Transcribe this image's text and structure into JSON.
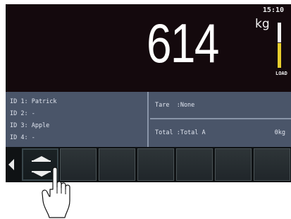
{
  "status": {
    "clock": "15:10",
    "unit": "kg",
    "weight": "614",
    "load_label": "LOAD",
    "load_level": 0.55
  },
  "ids": [
    {
      "label": "ID 1: Patrick"
    },
    {
      "label": "ID 2: -"
    },
    {
      "label": "ID 3: Apple"
    },
    {
      "label": "ID 4: -"
    }
  ],
  "tare": {
    "text": "Tare  :None"
  },
  "total": {
    "text": "Total :Total A",
    "value": "0kg"
  },
  "softkeys": {
    "back_icon": "left-triangle-icon",
    "scroll_icon": "up-down-arrows-icon",
    "empty_count_shown": 6
  },
  "cursor": {
    "icon": "pointing-hand-icon"
  }
}
